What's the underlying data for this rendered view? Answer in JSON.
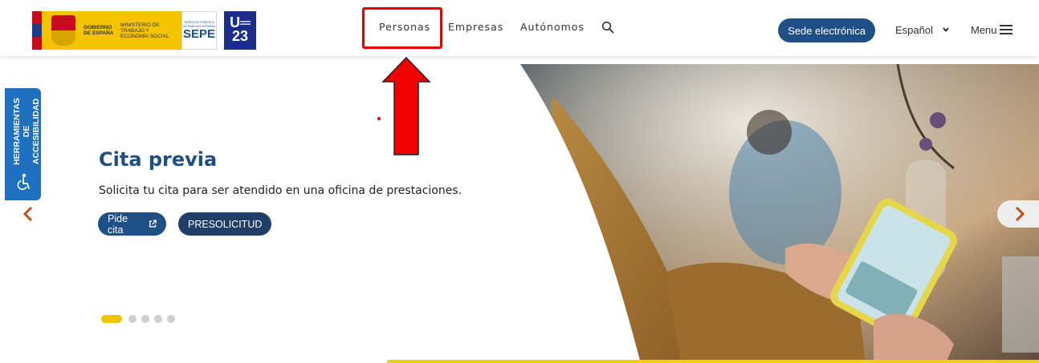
{
  "header": {
    "logos": {
      "gobierno": "GOBIERNO DE ESPAÑA",
      "ministerio": "MINISTERIO DE TRABAJO Y ECONOMÍA SOCIAL",
      "sepe_small": "SERVICIO PÚBLICO DE EMPLEO ESTATAL",
      "sepe": "SEPE",
      "ue_line1": "U═",
      "ue_line2": "23"
    },
    "nav": [
      "Personas",
      "Empresas",
      "Autónomos"
    ],
    "sede_button": "Sede electrónica",
    "language": "Español",
    "menu": "Menu"
  },
  "accessibility": {
    "label": "HERRAMIENTAS DE ACCESIBILIDAD"
  },
  "hero": {
    "title": "Cita previa",
    "subtitle": "Solicita tu cita para ser atendido en una oficina de prestaciones.",
    "buttons": [
      "Pide cita",
      "PRESOLICITUD"
    ],
    "slide_count": 5,
    "active_slide": 1
  },
  "colors": {
    "primary": "#1f4f87",
    "accent_yellow": "#f0c400",
    "annotation_red": "#e60000",
    "accessibility_blue": "#1f70c1"
  }
}
